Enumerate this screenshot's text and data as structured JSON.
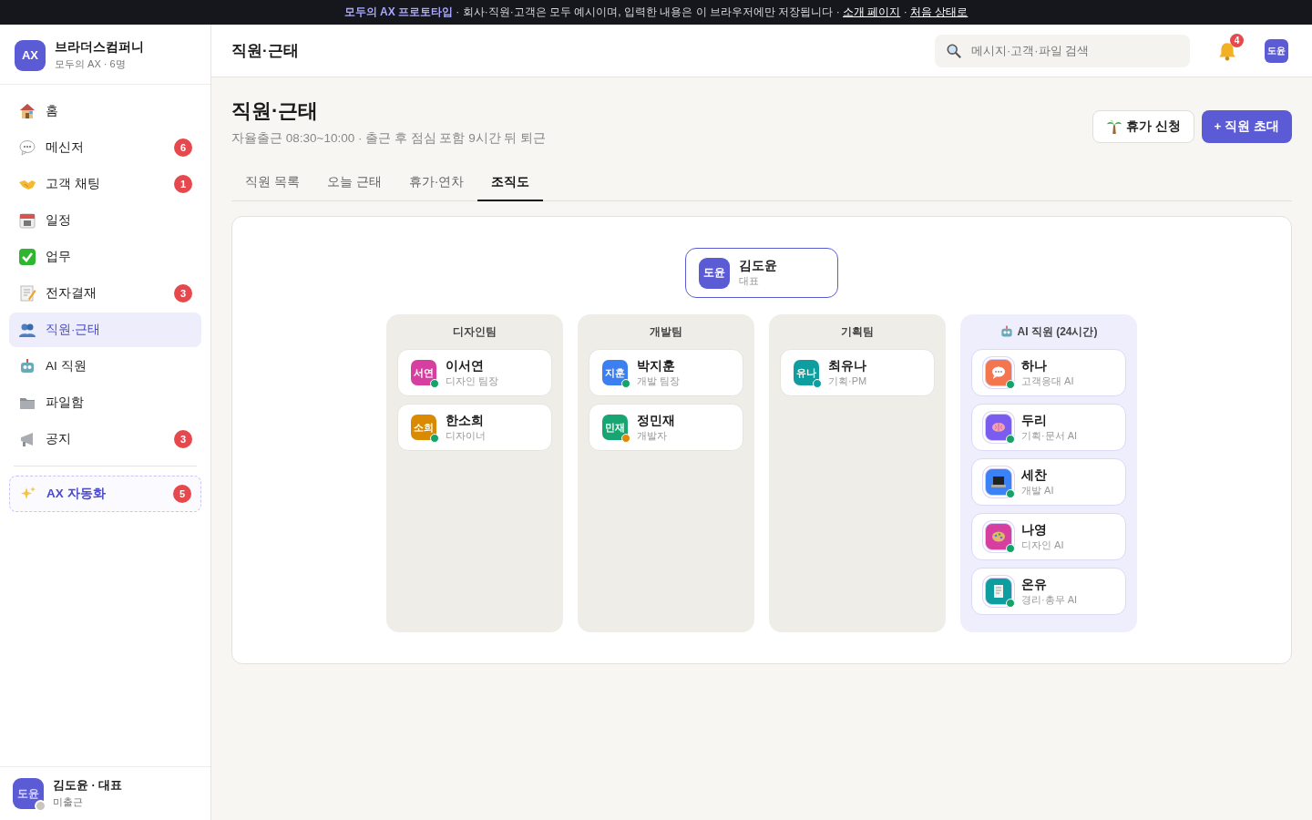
{
  "banner": {
    "parts": [
      {
        "kind": "strong",
        "text": "모두의 AX 프로토타입"
      },
      {
        "kind": "text",
        "text": " · 회사·직원·고객은 모두 예시이며, 입력한 내용은 이 브라우저에만 저장됩니다 · "
      },
      {
        "kind": "link",
        "text": "소개 페이지"
      },
      {
        "kind": "text",
        "text": " · "
      },
      {
        "kind": "link",
        "text": "처음 상태로"
      }
    ]
  },
  "sidebar": {
    "logo": "AX",
    "company": "브라더스컴퍼니",
    "subtitle": "모두의 AX · 6명",
    "items": [
      {
        "label": "홈",
        "selected": false
      },
      {
        "label": "메신저",
        "badge": "6",
        "selected": false
      },
      {
        "label": "고객 채팅",
        "badge": "1",
        "selected": false
      },
      {
        "label": "일정",
        "selected": false
      },
      {
        "label": "업무",
        "selected": false
      },
      {
        "label": "전자결재",
        "badge": "3",
        "selected": false
      },
      {
        "label": "직원·근태",
        "selected": true
      },
      {
        "label": "AI 직원",
        "selected": false
      },
      {
        "label": "파일함",
        "selected": false
      },
      {
        "label": "공지",
        "badge": "3",
        "selected": false
      }
    ],
    "automation": {
      "label": "AX 자동화",
      "badge": "5",
      "selected": false
    },
    "user": {
      "initials": "도윤",
      "name": "김도윤 · 대표",
      "status": "미출근",
      "color": "#c9c6c0"
    }
  },
  "header": {
    "title": "직원·근태",
    "search": {
      "placeholder": "메시지·고객·파일 검색"
    },
    "notifications": "4",
    "avatar": "도윤"
  },
  "page": {
    "title": "직원·근태",
    "subtitle": "자율출근 08:30~10:00 · 출근 후 점심 포함 9시간 뒤 퇴근",
    "buttons": [
      {
        "label": "휴가 신청",
        "kind": "secondary"
      },
      {
        "label": "+ 직원 초대",
        "kind": "primary"
      }
    ],
    "tabs": [
      {
        "label": "직원 목록",
        "selected": false
      },
      {
        "label": "오늘 근태",
        "selected": false
      },
      {
        "label": "휴가·연차",
        "selected": false
      },
      {
        "label": "조직도",
        "selected": true
      }
    ]
  },
  "org": {
    "top": {
      "initials": "도윤",
      "name": "김도윤",
      "role": "대표",
      "color": "#5b5bd6"
    },
    "teams": [
      {
        "name": "디자인팀",
        "kind": "team",
        "members": [
          {
            "initials": "서연",
            "name": "이서연",
            "role": "디자인 팀장",
            "color": "#d63fa0",
            "status": {
              "color": "#16a36a"
            }
          },
          {
            "initials": "소희",
            "name": "한소희",
            "role": "디자이너",
            "color": "#d98a00",
            "status": {
              "color": "#16a36a"
            }
          }
        ]
      },
      {
        "name": "개발팀",
        "kind": "team",
        "members": [
          {
            "initials": "지훈",
            "name": "박지훈",
            "role": "개발 팀장",
            "color": "#3b7ff0",
            "status": {
              "color": "#16a36a"
            }
          },
          {
            "initials": "민재",
            "name": "정민재",
            "role": "개발자",
            "color": "#17a673",
            "status": {
              "color": "#e08a00"
            }
          }
        ]
      },
      {
        "name": "기획팀",
        "kind": "team",
        "members": [
          {
            "initials": "유나",
            "name": "최유나",
            "role": "기획·PM",
            "color": "#0f9ea0",
            "status": {
              "color": "#0f9ea0"
            }
          }
        ]
      },
      {
        "name": "AI 직원 (24시간)",
        "kind": "ai",
        "members": [
          {
            "name": "하나",
            "role": "고객응대 AI",
            "color": "#f4764f",
            "status": {
              "color": "#16a36a"
            }
          },
          {
            "name": "두리",
            "role": "기획·문서 AI",
            "color": "#7a5cf0",
            "status": {
              "color": "#16a36a"
            }
          },
          {
            "name": "세찬",
            "role": "개발 AI",
            "color": "#3b82f6",
            "status": {
              "color": "#16a36a"
            }
          },
          {
            "name": "나영",
            "role": "디자인 AI",
            "color": "#d63fa0",
            "status": {
              "color": "#16a36a"
            }
          },
          {
            "name": "온유",
            "role": "경리·총무 AI",
            "color": "#0f9ea0",
            "status": {
              "color": "#16a36a"
            }
          }
        ]
      }
    ]
  }
}
